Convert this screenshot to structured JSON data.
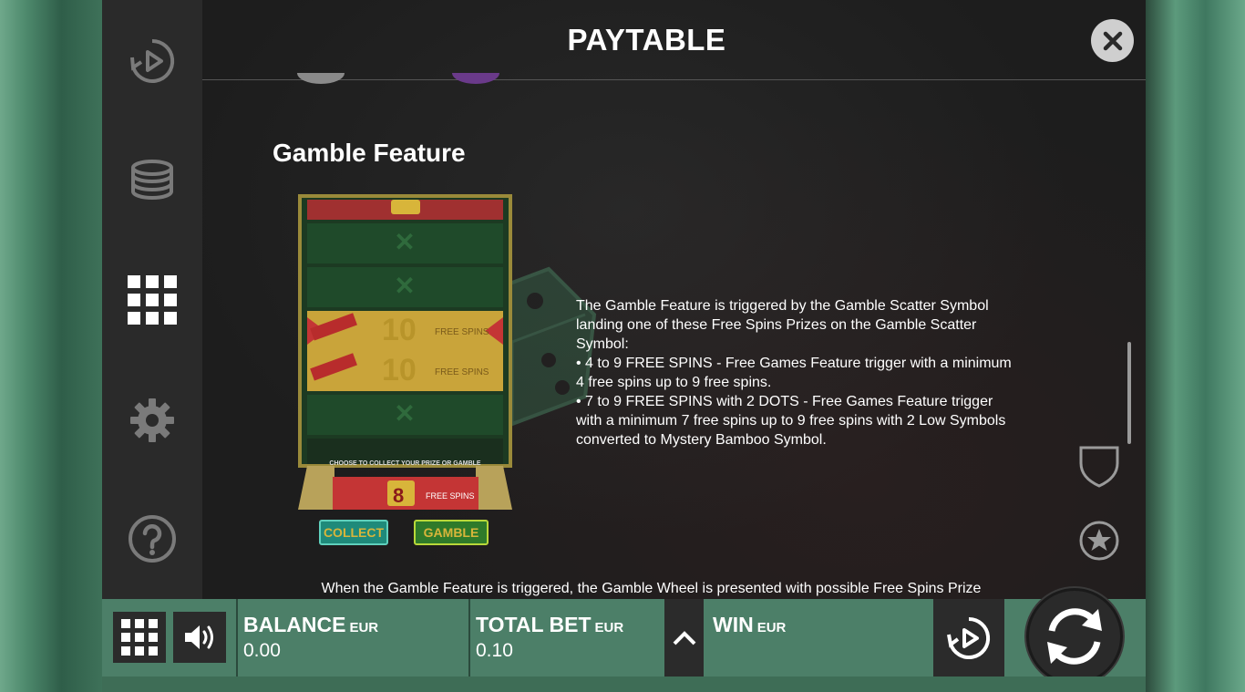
{
  "panel": {
    "title": "PAYTABLE",
    "section_title": "Gamble Feature",
    "description": [
      "The Gamble Feature is triggered by the Gamble Scatter Symbol landing one of these Free Spins Prizes on the Gamble Scatter Symbol:",
      "• 4 to 9 FREE SPINS - Free Games Feature trigger with a minimum 4 free spins up to 9 free spins.",
      "• 7 to 9 FREE SPINS with 2 DOTS - Free Games Feature trigger with a minimum 7 free spins up to 9 free spins with 2 Low Symbols converted to Mystery Bamboo Symbol."
    ],
    "bottom_text": "When the Gamble Feature is triggered, the Gamble Wheel is presented with possible Free Spins Prize"
  },
  "graphic": {
    "row_value_1": "10",
    "row_label_1": "FREE SPINS",
    "row_value_2": "10",
    "row_label_2": "FREE SPINS",
    "prompt": "CHOOSE TO COLLECT YOUR PRIZE OR GAMBLE",
    "prize_value": "8",
    "prize_label": "FREE SPINS",
    "collect_label": "COLLECT",
    "gamble_label": "GAMBLE"
  },
  "side_menu": {
    "icons": [
      "autoplay-icon",
      "coins-icon",
      "paytable-grid-icon",
      "gear-icon",
      "help-icon"
    ]
  },
  "bottom_bar": {
    "balance_label": "BALANCE",
    "balance_unit": "EUR",
    "balance_value": "0.00",
    "bet_label": "TOTAL BET",
    "bet_unit": "EUR",
    "bet_value": "0.10",
    "win_label": "WIN",
    "win_unit": "EUR"
  },
  "colors": {
    "panel_bg": "#1d1d1d",
    "menu_bg": "#2a2a2a",
    "bar_bg": "#4c7f68",
    "accent_gold": "#d8b53a",
    "accent_red": "#c43535"
  }
}
